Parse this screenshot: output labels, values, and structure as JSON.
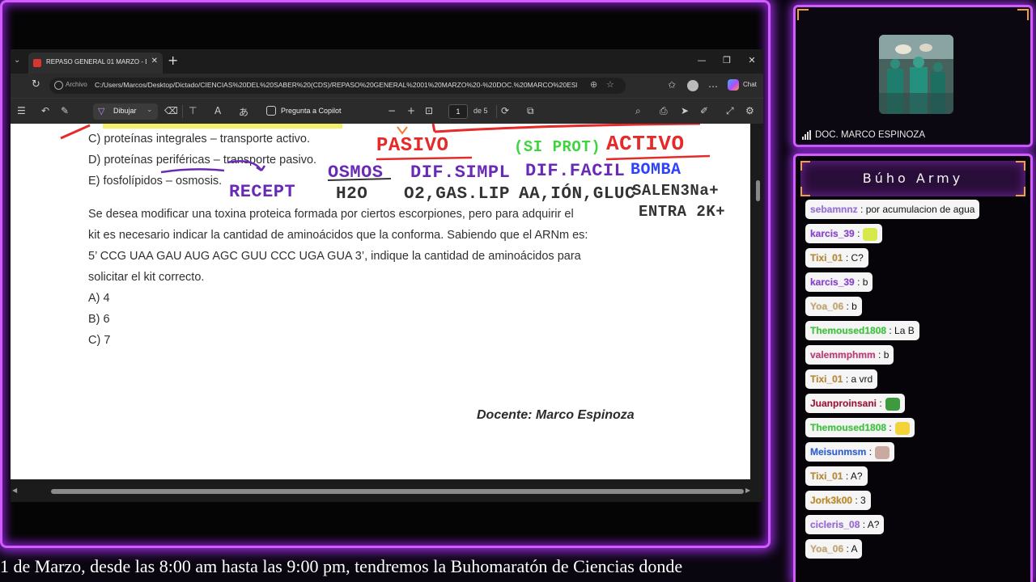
{
  "browser": {
    "tab_title": "REPASO GENERAL 01 MARZO - DOC",
    "address_label": "Archivo",
    "url": "C:/Users/Marcos/Desktop/Dictado/CIENCIAS%20DEL%20SABER%20(CDS)/REPASO%20GENERAL%2001%20MARZO%20-%20DOC.%20MARCO%20ESPIN...",
    "chat_label": "Chat"
  },
  "pdf_toolbar": {
    "draw_label": "Dibujar",
    "copilot_label": "Pregunta a Copilot",
    "page_current": "1",
    "page_total": "de 5"
  },
  "document": {
    "option_c_prev": "C) proteínas integrales – transporte activo.",
    "option_d_prev": "D) proteínas periféricas – transporte pasivo.",
    "option_e_prev": "E) fosfolípidos – osmosis.",
    "question_lines": [
      "Se desea modificar una toxina proteica formada por ciertos escorpiones, pero para adquirir el",
      "kit es necesario indicar la cantidad de aminoácidos que la conforma. Sabiendo que el ARNm es:",
      "5’ CCG UAA GAU AUG AGC GUU CCC UGA GUA 3’, indique la cantidad de aminoácidos para",
      "solicitar el kit correcto."
    ],
    "answers": [
      "A) 4",
      "B) 6",
      "C) 7"
    ],
    "teacher": "Docente: Marco Espinoza"
  },
  "annotations": {
    "pasivo": "PASIVO",
    "sin_prot": "(SI PROT)",
    "activo": "ACTIVO",
    "osmos": "OSMOS",
    "dif_simpl": "DIF.SIMPL",
    "dif_facil": "DIF.FACIL",
    "bomba": "BOMBA",
    "recept": "RECEPT",
    "h2o": "H2O",
    "o2_gas_lip": "O2,GAS.LIP",
    "aa_ion_gluc": "AA,IÓN,GLUC",
    "sale_3na": "SALEN3Na+",
    "entra_2k": "ENTRA 2K+"
  },
  "ticker": "1 de Marzo, desde las 8:00 am hasta las 9:00 pm, tendremos la Buhomaratón de Ciencias donde",
  "camera": {
    "name": "DOC. MARCO ESPINOZA"
  },
  "chat": {
    "title": "Búho Army",
    "messages": [
      {
        "user": "sebamnnz",
        "text": ": por acumulacion de agua",
        "color": "#9b6fe0"
      },
      {
        "user": "karcis_39",
        "text": ":",
        "color": "#8a3dd6",
        "emote": "#d6e84a"
      },
      {
        "user": "Tixi_01",
        "text": ": C?",
        "color": "#b8892f"
      },
      {
        "user": "karcis_39",
        "text": ": b",
        "color": "#8a3dd6"
      },
      {
        "user": "Yoa_06",
        "text": ": b",
        "color": "#c7a56a"
      },
      {
        "user": "Themoused1808",
        "text": ": La B",
        "color": "#36c936"
      },
      {
        "user": "valemmphmm",
        "text": ": b",
        "color": "#c2387a"
      },
      {
        "user": "Tixi_01",
        "text": ": a vrd",
        "color": "#b8892f"
      },
      {
        "user": "Juanproinsani",
        "text": ":",
        "color": "#a1123a",
        "emote": "#3f9a3f"
      },
      {
        "user": "Themoused1808",
        "text": ":",
        "color": "#36c936",
        "emote": "#f2d33a"
      },
      {
        "user": "Meisunmsm",
        "text": ":",
        "color": "#2b5fd6",
        "emote": "#c9a9a0"
      },
      {
        "user": "Tixi_01",
        "text": ": A?",
        "color": "#b8892f"
      },
      {
        "user": "Jork3k00",
        "text": ": 3",
        "color": "#c08a1e"
      },
      {
        "user": "cicleris_08",
        "text": ": A?",
        "color": "#9a67d8"
      },
      {
        "user": "Yoa_06",
        "text": ": A",
        "color": "#c7a56a"
      }
    ]
  }
}
